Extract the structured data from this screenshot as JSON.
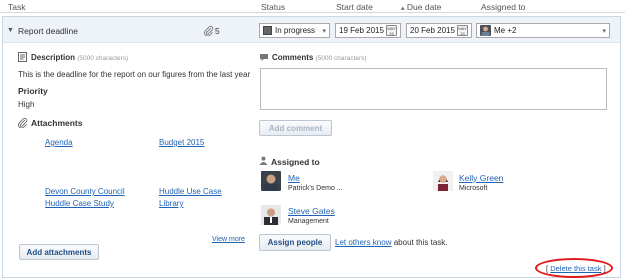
{
  "headers": {
    "task": "Task",
    "status": "Status",
    "start_date": "Start date",
    "due_date": "Due date",
    "due_sort_glyph": "▴",
    "assigned_to": "Assigned to"
  },
  "task": {
    "expander_glyph": "▼",
    "title": "Report deadline",
    "attachment_count": "5",
    "status_value": "In progress",
    "start_date_value": "19 Feb 2015",
    "due_date_value": "20 Feb 2015",
    "assigned_value": "Me +2",
    "dropdown_glyph": "▾"
  },
  "description": {
    "label": "Description",
    "hint": "(5000 characters)",
    "text": "This is the deadline for the report on our figures from the last year"
  },
  "priority": {
    "label": "Priority",
    "value": "High"
  },
  "attachments": {
    "label": "Attachments",
    "items": [
      "Agenda",
      "Budget 2015",
      "Devon County Council",
      "Huddle Use Case",
      "Huddle Case Study",
      "Library"
    ],
    "view_more": "View more",
    "add_button": "Add attachments"
  },
  "comments": {
    "label": "Comments",
    "hint": "(5000 characters)",
    "add_button": "Add comment"
  },
  "assigned": {
    "label": "Assigned to",
    "people": [
      {
        "name": "Me",
        "org": "Patrick's Demo ..."
      },
      {
        "name": "Kelly Green",
        "org": "Microsoft"
      },
      {
        "name": "Steve Gates",
        "org": "Management"
      }
    ],
    "assign_button": "Assign people",
    "let_others_know": "Let others know",
    "about_text": "about this task."
  },
  "delete": {
    "bracket_open": "[",
    "label": "Delete this task",
    "bracket_close": "]"
  },
  "calendar_icon_text": "MAY\n15",
  "colors": {
    "accent_link": "#1f63b5",
    "row_bg": "#eef3f9",
    "highlight_ring": "#e21a1a"
  }
}
